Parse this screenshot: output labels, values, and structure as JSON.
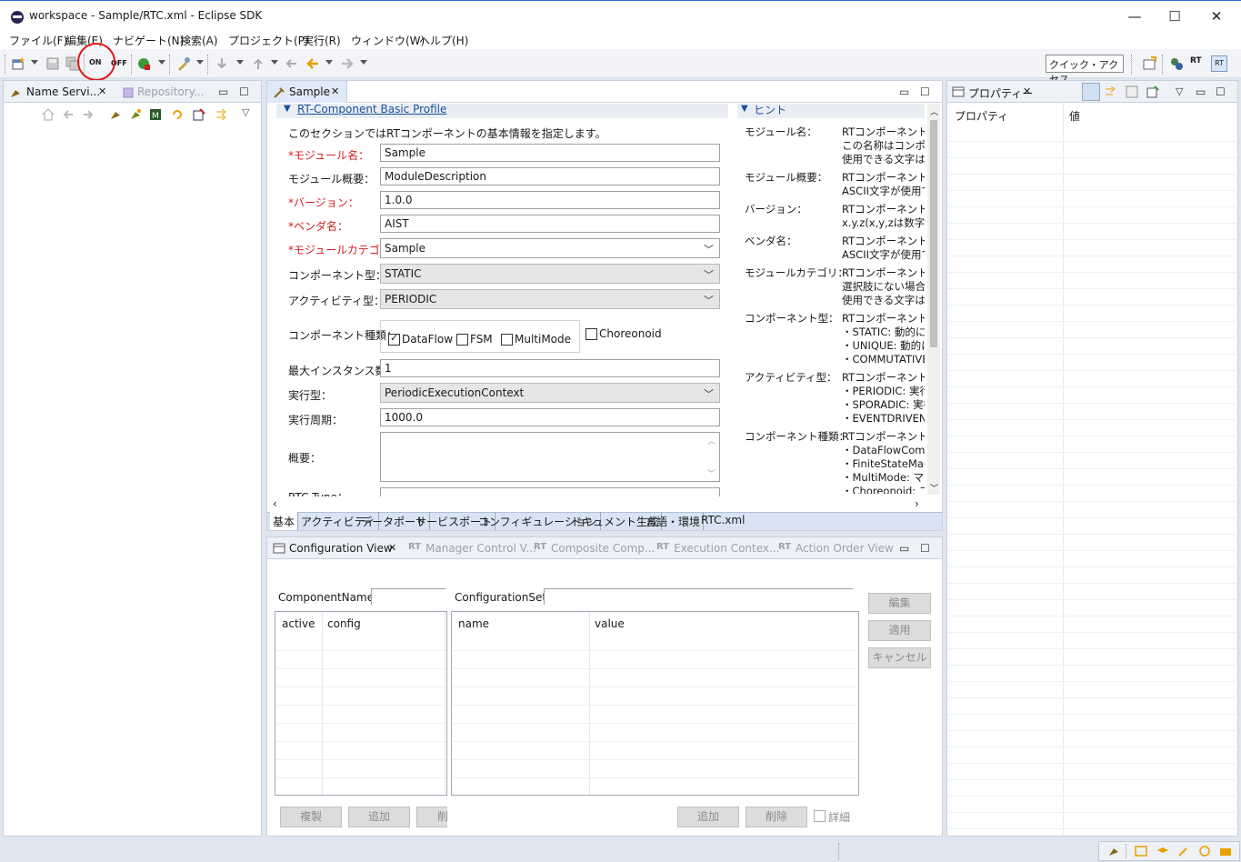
{
  "window": {
    "title": "workspace - Sample/RTC.xml - Eclipse SDK",
    "minimize": "—",
    "maximize": "☐",
    "close": "✕"
  },
  "menu": [
    "ファイル(F)",
    "編集(E)",
    "ナビゲート(N)",
    "検索(A)",
    "プロジェクト(P)",
    "実行(R)",
    "ウィンドウ(W)",
    "ヘルプ(H)"
  ],
  "toolbar": {
    "quick_access": "クイック・アクセス",
    "on_label": "ON",
    "off_label": "OFF",
    "rt_label": "RT"
  },
  "left_panel": {
    "tab1": "Name Servi...",
    "tab2": "Repository..."
  },
  "editor": {
    "tab": "Sample",
    "section_title": "RT-Component Basic Profile",
    "intro": "このセクションではRTコンポーネントの基本情報を指定します。",
    "fields": {
      "module_name_label": "*モジュール名：",
      "module_name": "Sample",
      "module_desc_label": "モジュール概要：",
      "module_desc": "ModuleDescription",
      "version_label": "*バージョン：",
      "version": "1.0.0",
      "vendor_label": "*ベンダ名：",
      "vendor": "AIST",
      "category_label": "*モジュールカテゴリ：",
      "category": "Sample",
      "comp_type_label": "コンポーネント型：",
      "comp_type": "STATIC",
      "activity_type_label": "アクティビティ型：",
      "activity_type": "PERIODIC",
      "comp_kind_label": "コンポーネント種類：",
      "kind_dataflow": "DataFlow",
      "kind_fsm": "FSM",
      "kind_multimode": "MultiMode",
      "kind_choreonoid": "Choreonoid",
      "max_inst_label": "最大インスタンス数：",
      "max_inst": "1",
      "exec_type_label": "実行型：",
      "exec_type": "PeriodicExecutionContext",
      "exec_rate_label": "実行周期：",
      "exec_rate": "1000.0",
      "overview_label": "概要：",
      "rtc_type_label": "RTC Type："
    },
    "hint_title": "ヒント",
    "hints": [
      {
        "label": "モジュール名：",
        "lines": [
          "RTコンポーネントを識",
          "この名称はコンポーネ",
          "使用できる文字は英"
        ]
      },
      {
        "label": "モジュール概要：",
        "lines": [
          "RTコンポーネントが扱",
          "ASCII文字が使用で"
        ]
      },
      {
        "label": "バージョン：",
        "lines": [
          "RTコンポーネントのバ",
          "x.y.z(x,y,zは数字)の"
        ]
      },
      {
        "label": "ベンダ名：",
        "lines": [
          "RTコンポーネントを作",
          "ASCII文字が使用で"
        ]
      },
      {
        "label": "モジュールカテゴリ：",
        "lines": [
          "RTコンポーネントのカ",
          "選択肢にない場合は",
          "使用できる文字は、"
        ]
      },
      {
        "label": "コンポーネント型：",
        "lines": [
          "RTコンポーネントの型",
          "・STATIC: 動的に生",
          "・UNIQUE: 動的に",
          "・COMMUTATIVE"
        ]
      },
      {
        "label": "アクティビティ型：",
        "lines": [
          "RTコンポーネントのア",
          "・PERIODIC: 実行周",
          "・SPORADIC: 実行",
          "・EVENTDRIVEN: イ"
        ]
      },
      {
        "label": "コンポーネント種類：",
        "lines": [
          "RTコンポーネントの種",
          "・DataFlowCompo",
          "・FiniteStateMach",
          "・MultiMode: マル",
          "・Choreonoid: コレ"
        ]
      }
    ],
    "bottom_tabs": [
      "基本",
      "アクティビティ",
      "データポート",
      "サービスポート",
      "コンフィギュレーション",
      "ドキュメント生成",
      "言語・環境",
      "RTC.xml"
    ]
  },
  "properties": {
    "tab": "プロパティー",
    "col_property": "プロパティ",
    "col_value": "値"
  },
  "config_view": {
    "tabs": [
      "Configuration View",
      "Manager Control V...",
      "Composite Comp...",
      "Execution Contex...",
      "Action Order View"
    ],
    "component_name_label": "ComponentName:",
    "configuration_set_label": "ConfigurationSet:",
    "left_cols": [
      "active",
      "config"
    ],
    "right_cols": [
      "name",
      "value"
    ],
    "btn_edit": "編集",
    "btn_apply": "適用",
    "btn_cancel": "キャンセル",
    "btn_copy": "複製",
    "btn_add_left": "追加",
    "btn_delete_left": "削",
    "btn_add_right": "追加",
    "btn_delete_right": "削除",
    "detail_label": "詳細"
  }
}
